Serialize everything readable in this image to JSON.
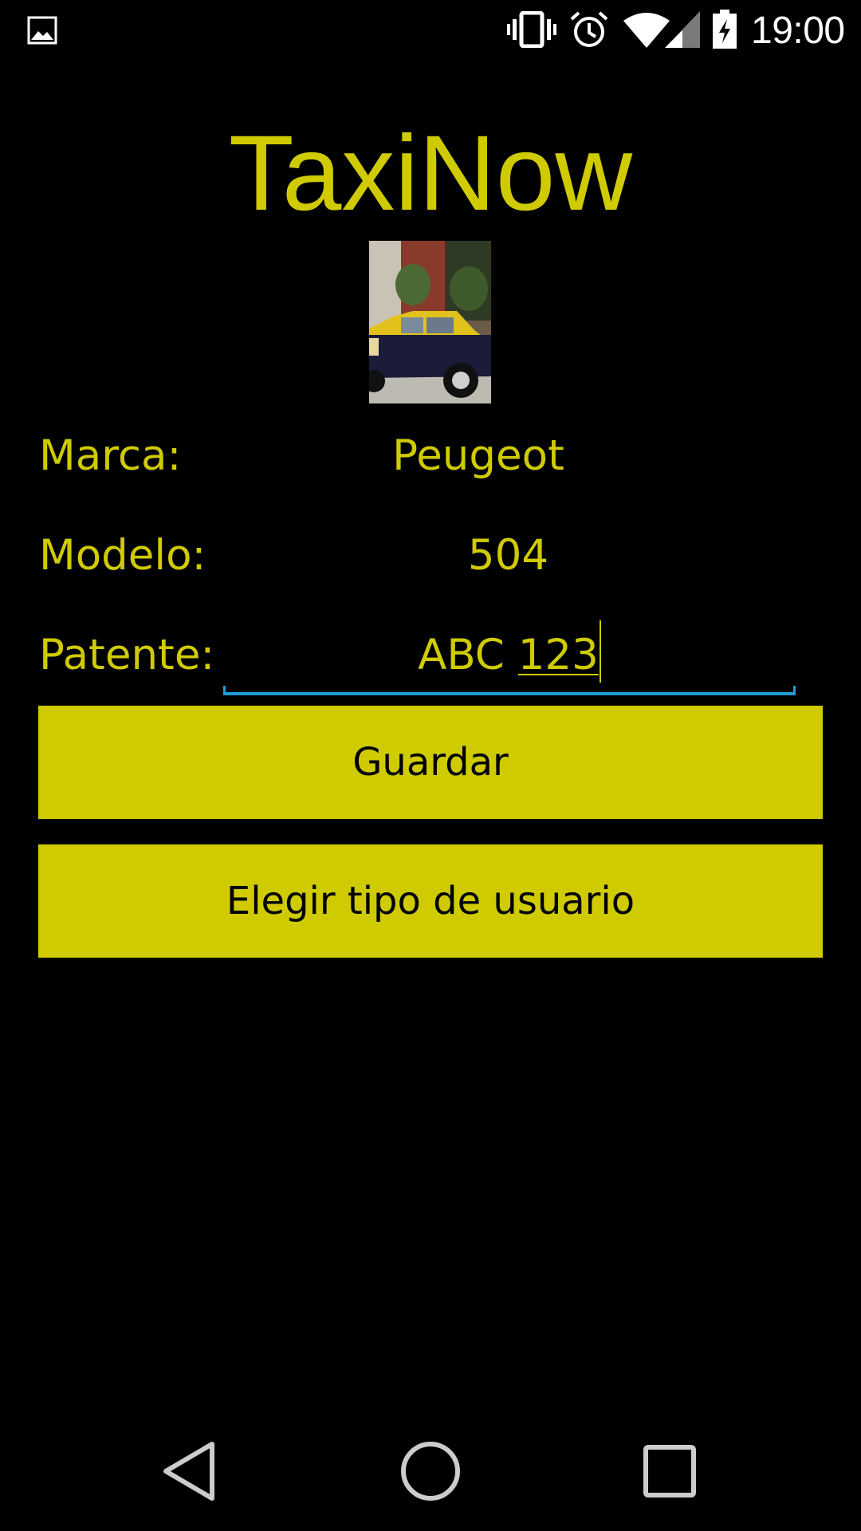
{
  "status_bar": {
    "time": "19:00",
    "icons": [
      "gallery-icon",
      "vibrate-icon",
      "alarm-icon",
      "wifi-icon",
      "signal-icon",
      "battery-charging-icon"
    ]
  },
  "app": {
    "title": "TaxiNow",
    "image_description_icon": "taxi-photo",
    "fields": {
      "marca": {
        "label": "Marca:",
        "value": "Peugeot"
      },
      "modelo": {
        "label": "Modelo:",
        "value": "504"
      },
      "patente": {
        "label": "Patente:",
        "value_prefix": "ABC",
        "value_suffix": "123"
      }
    },
    "buttons": {
      "guardar": "Guardar",
      "elegir_tipo": "Elegir tipo de usuario"
    }
  },
  "nav_bar": {
    "icons": [
      "back-icon",
      "home-icon",
      "recents-icon"
    ]
  },
  "colors": {
    "background": "#000000",
    "accent": "#cfcb00",
    "input_focus": "#1e9bd7",
    "button_text": "#000000"
  }
}
